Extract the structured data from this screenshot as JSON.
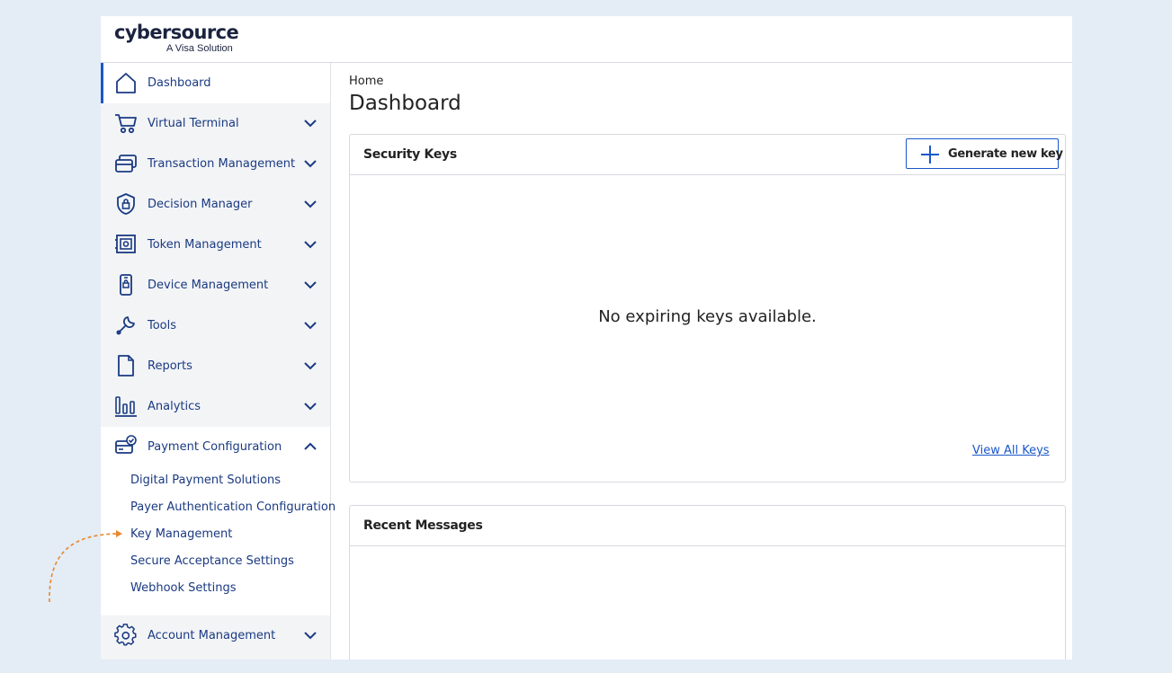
{
  "brand": {
    "name": "cybersource",
    "tagline": "A Visa Solution"
  },
  "sidebar": {
    "items": [
      {
        "label": "Dashboard",
        "icon": "home-icon",
        "active": true
      },
      {
        "label": "Virtual Terminal",
        "icon": "cart-icon",
        "expandable": true
      },
      {
        "label": "Transaction Management",
        "icon": "cards-icon",
        "expandable": true
      },
      {
        "label": "Decision Manager",
        "icon": "shield-lock-icon",
        "expandable": true
      },
      {
        "label": "Token Management",
        "icon": "vault-icon",
        "expandable": true
      },
      {
        "label": "Device Management",
        "icon": "mobile-device-icon",
        "expandable": true
      },
      {
        "label": "Tools",
        "icon": "wrench-icon",
        "expandable": true
      },
      {
        "label": "Reports",
        "icon": "document-icon",
        "expandable": true
      },
      {
        "label": "Analytics",
        "icon": "bar-chart-icon",
        "expandable": true
      },
      {
        "label": "Payment Configuration",
        "icon": "card-check-icon",
        "expandable": true,
        "expanded": true
      },
      {
        "label": "Account Management",
        "icon": "gear-icon",
        "expandable": true
      }
    ],
    "payment_configuration_subitems": [
      "Digital Payment Solutions",
      "Payer Authentication Configuration",
      "Key Management",
      "Secure Acceptance Settings",
      "Webhook Settings"
    ]
  },
  "main": {
    "breadcrumb": "Home",
    "title": "Dashboard",
    "security_keys": {
      "title": "Security Keys",
      "generate_button": "Generate new key",
      "empty_message": "No expiring keys available.",
      "view_all_link": "View All Keys"
    },
    "recent_messages": {
      "title": "Recent Messages"
    }
  },
  "colors": {
    "accent": "#1a56c8",
    "nav_text": "#1a3a82",
    "background": "#e4ecf6",
    "annotation_arrow": "#e8882a"
  }
}
